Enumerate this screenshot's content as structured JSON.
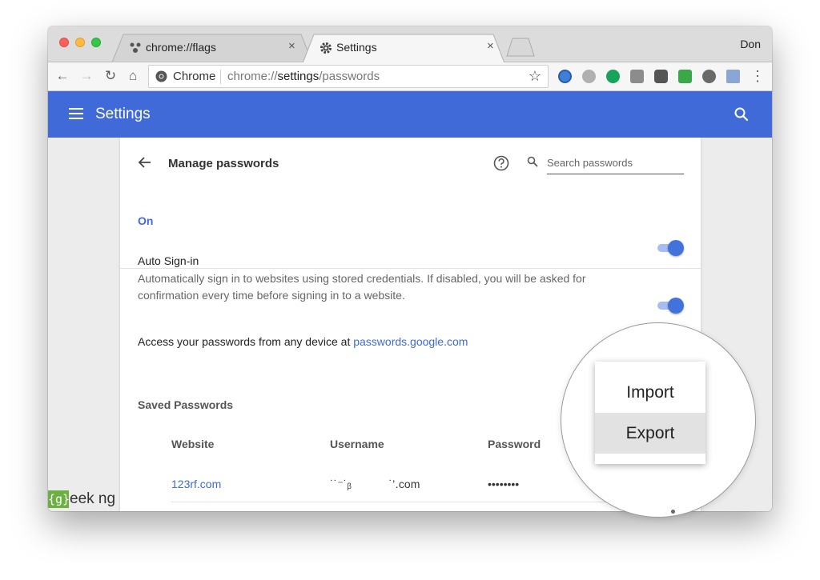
{
  "browser": {
    "tabs": [
      {
        "label": "chrome://flags",
        "close": "×"
      },
      {
        "label": "Settings",
        "close": "×"
      }
    ],
    "profile_name": "Don",
    "omnibox": {
      "chip": "Chrome",
      "url_prefix": "chrome://",
      "url_bold": "settings",
      "url_suffix": "/passwords"
    }
  },
  "settings": {
    "header_title": "Settings"
  },
  "passwords": {
    "title": "Manage passwords",
    "search_placeholder": "Search passwords",
    "on_label": "On",
    "auto_signin_title": "Auto Sign-in",
    "auto_signin_desc": "Automatically sign in to websites using stored credentials. If disabled, you will be asked for confirmation every time before signing in to a website.",
    "access_text": "Access your passwords from any device at ",
    "access_link": "passwords.google.com",
    "saved_title": "Saved Passwords",
    "columns": [
      "Website",
      "Username",
      "Password"
    ],
    "rows": [
      {
        "website": "123rf.com",
        "username": "˙˙⁻˙ᵦ          ˙’․com",
        "password": "••••••••"
      }
    ]
  },
  "callout_menu": {
    "items": [
      "Import",
      "Export"
    ]
  },
  "watermark": {
    "box": "{g}",
    "text": "eek ng"
  },
  "colors": {
    "accent": "#3f6ad8",
    "toggle_knob": "#4272db",
    "watermark_green": "#6bb13f"
  },
  "toggles": {
    "on": true,
    "auto_signin": true
  }
}
